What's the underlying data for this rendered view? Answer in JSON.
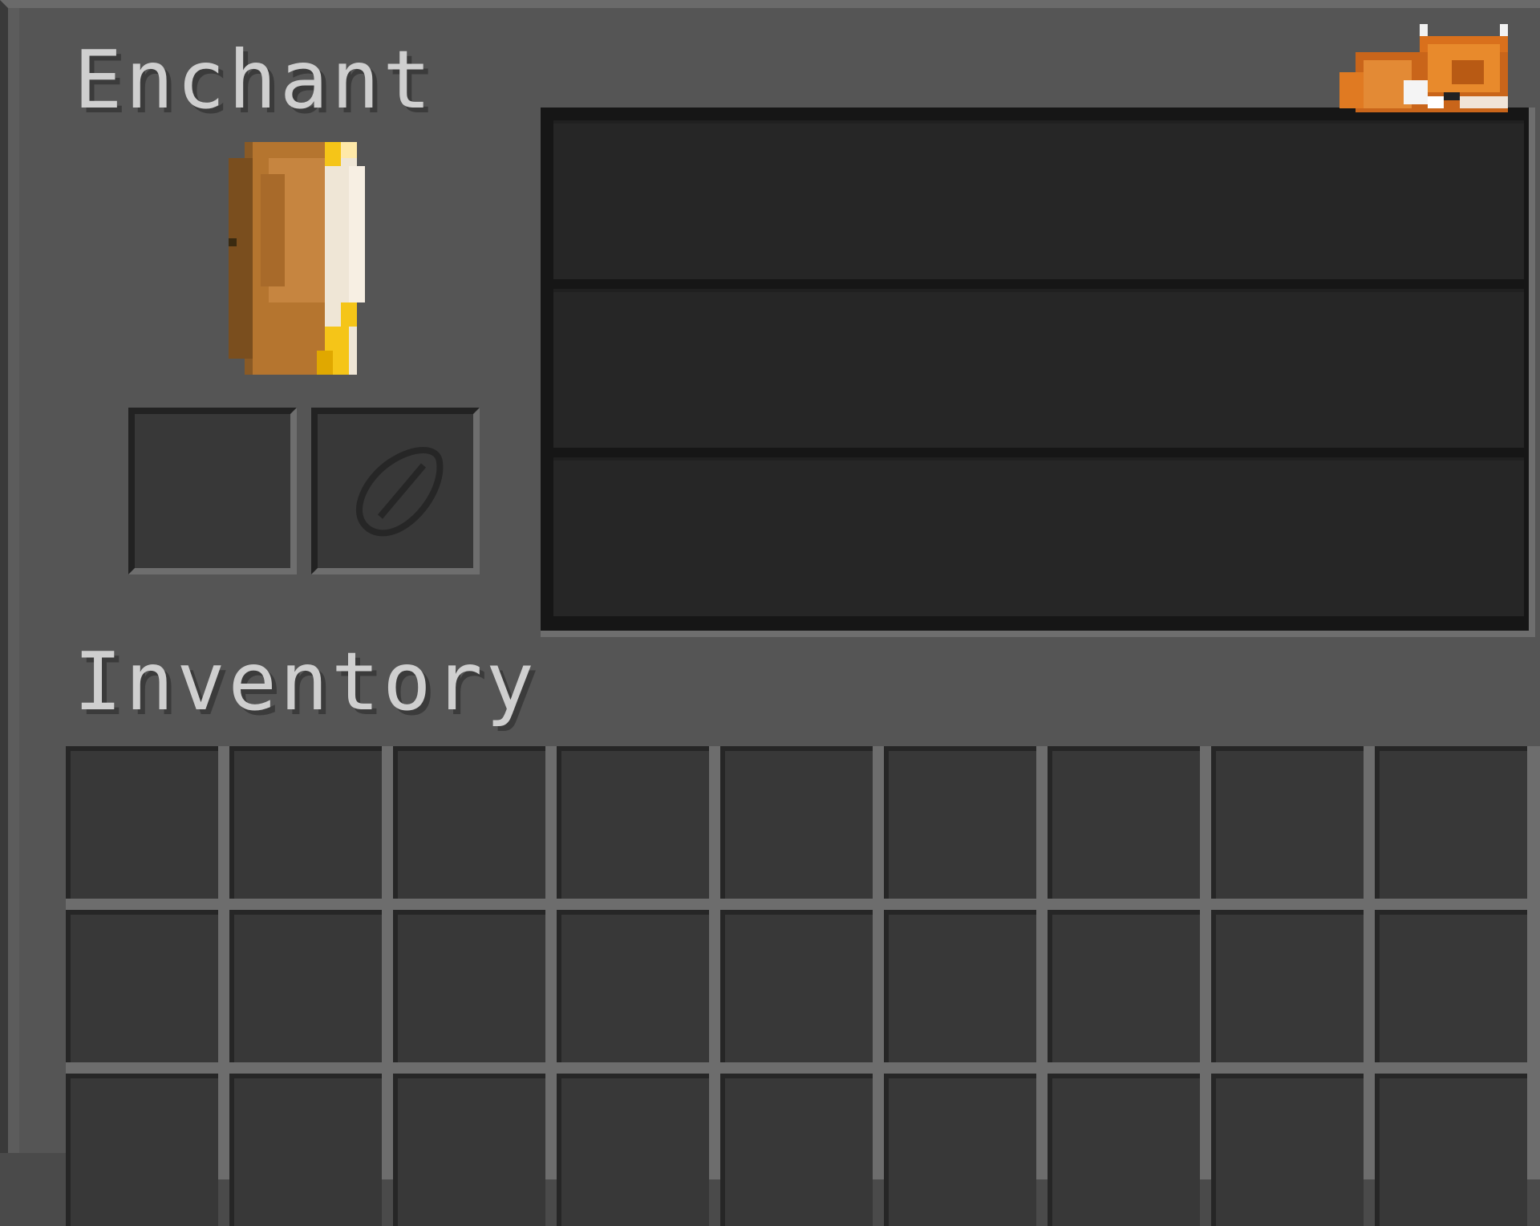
{
  "enchant": {
    "title": "Enchant",
    "book_icon": "enchanting-book-icon",
    "item_slot": {
      "icon": null
    },
    "lapis_slot": {
      "icon": "lapis-placeholder-icon"
    },
    "options": [
      {
        "label": ""
      },
      {
        "label": ""
      },
      {
        "label": ""
      }
    ]
  },
  "decoration": {
    "icon": "sleeping-fox-icon"
  },
  "inventory": {
    "title": "Inventory",
    "rows_visible": 3,
    "columns": 9
  },
  "colors": {
    "panel": "#555555",
    "slot": "#383838",
    "option": "#262626",
    "text": "#cfcfcf",
    "book_gold": "#f5c518",
    "book_leather": "#c68540",
    "fox": "#e07a22"
  }
}
